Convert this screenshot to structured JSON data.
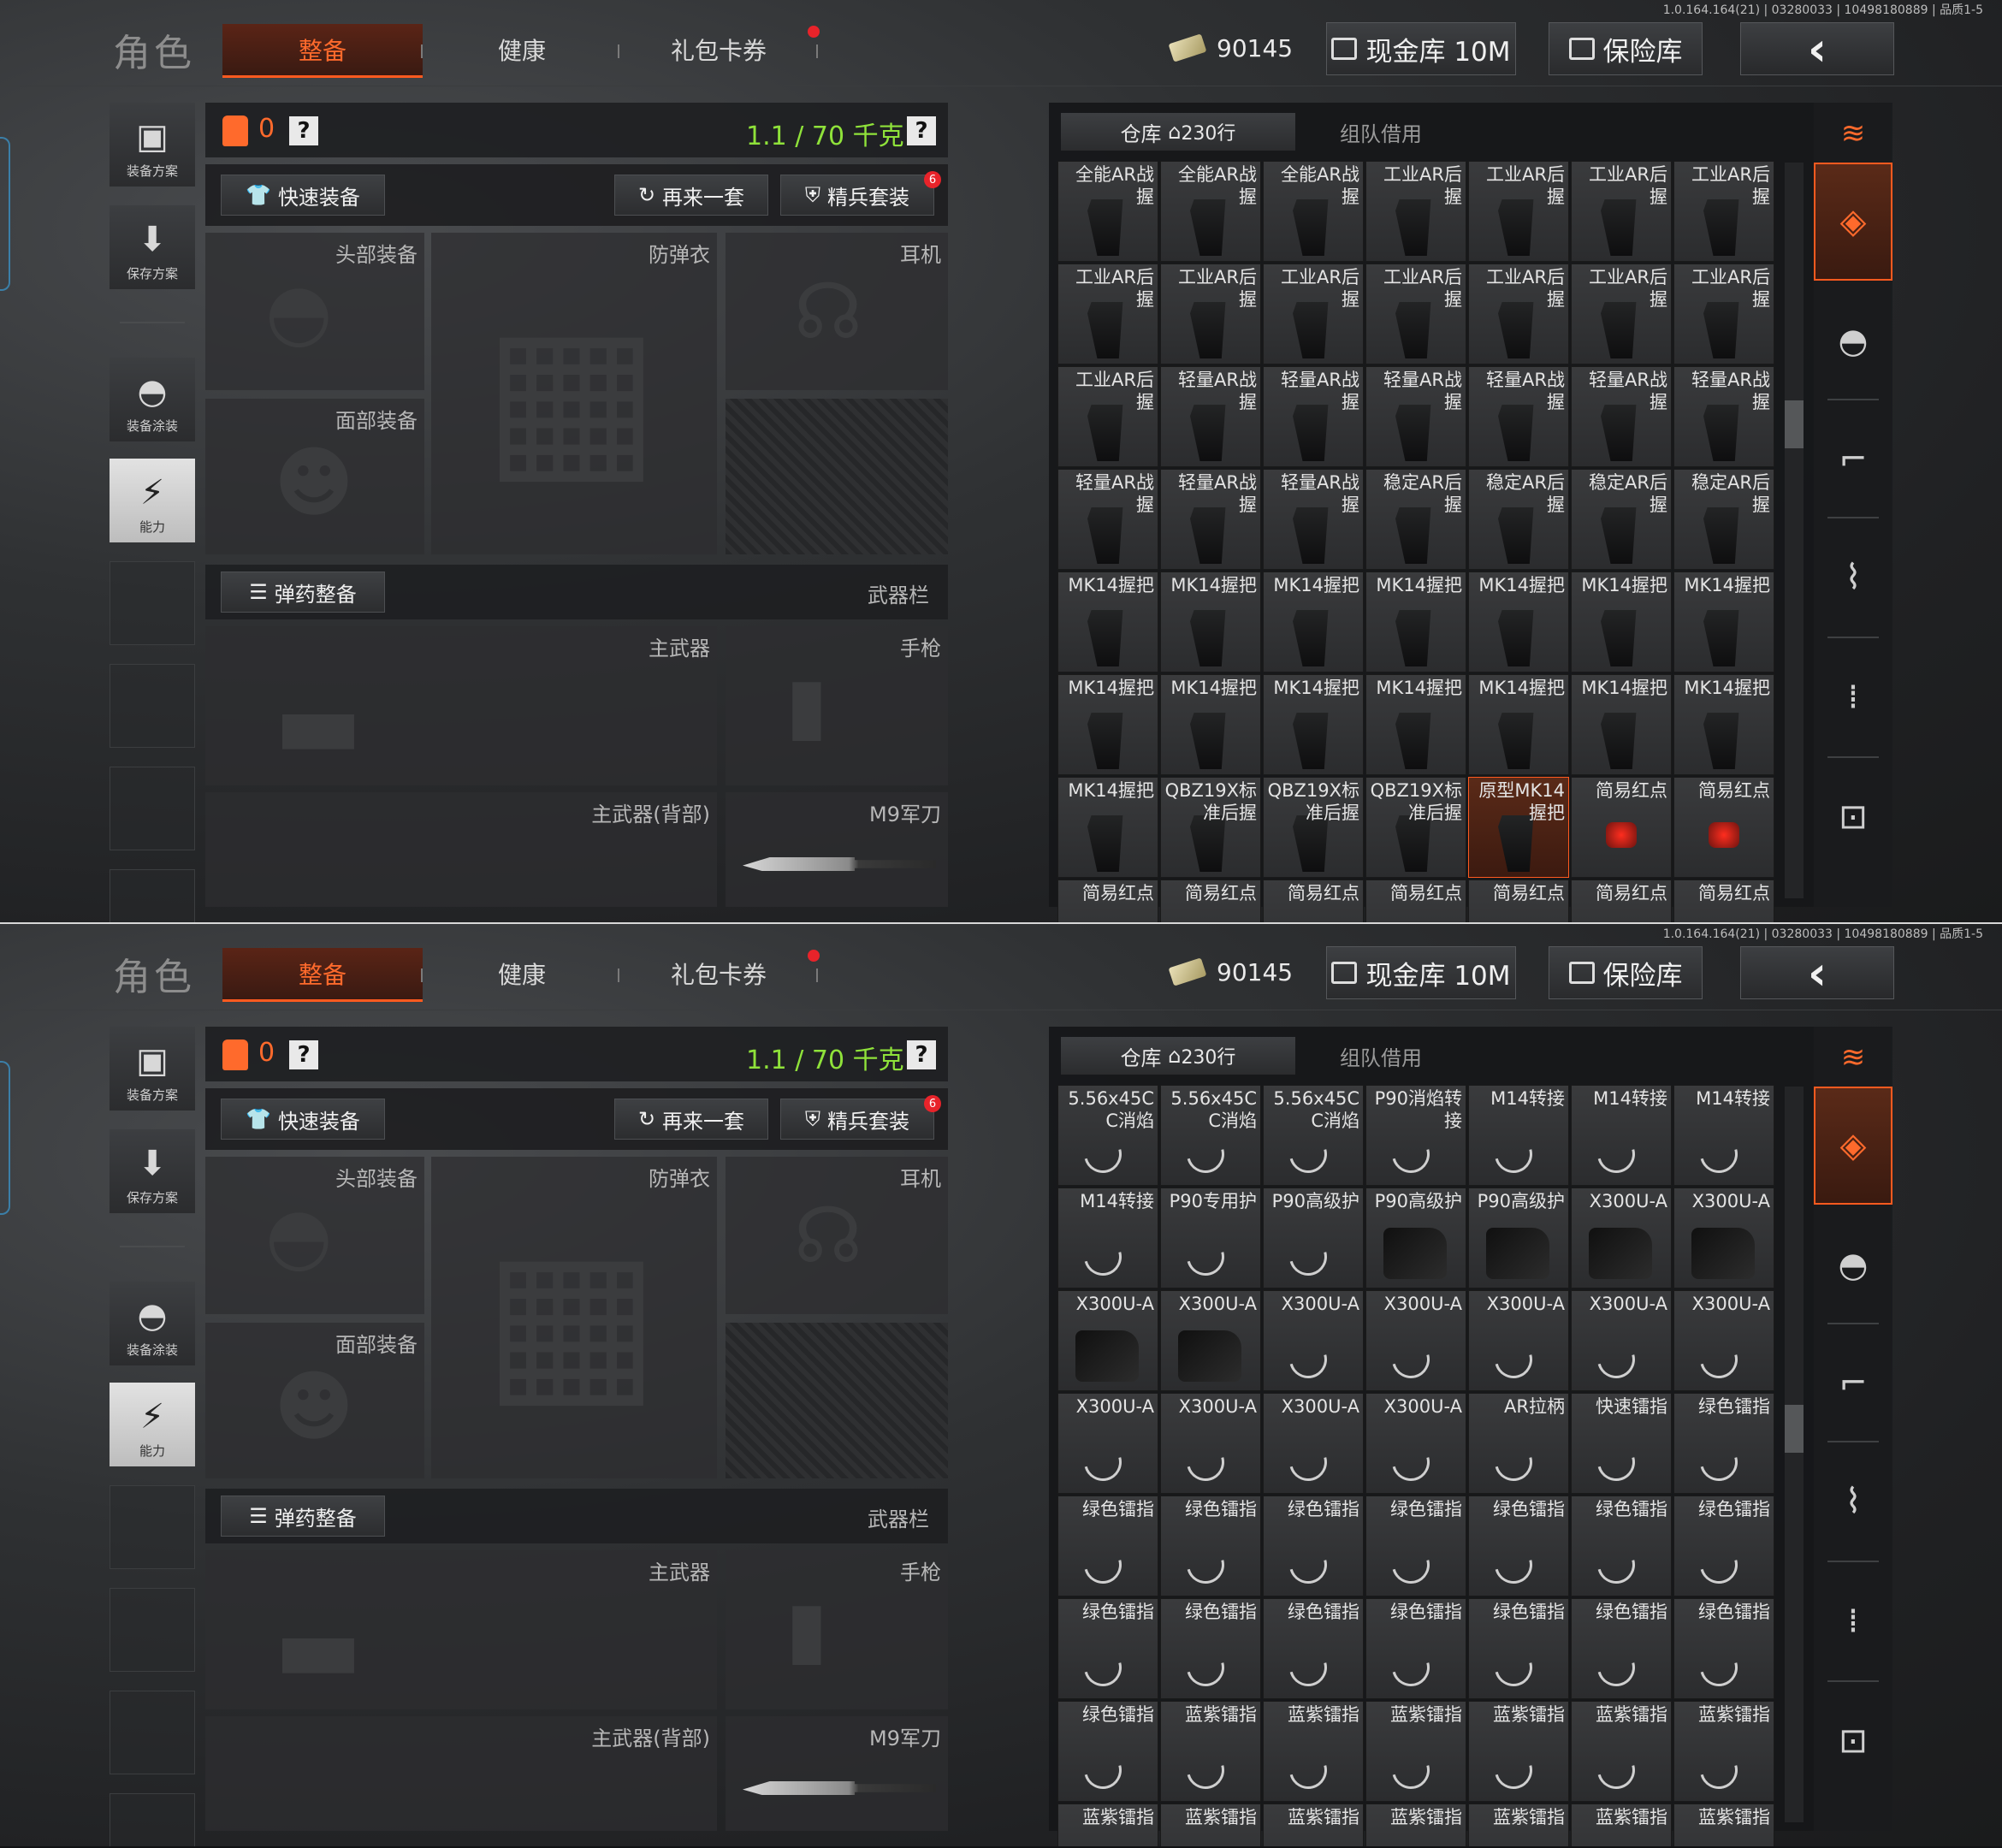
{
  "version": "1.0.164.164(21) | 03280033 | 10498180889 | 品质1-5",
  "header": {
    "role": "角色",
    "tabs": [
      "整备",
      "健康",
      "礼包卡券"
    ],
    "money": "90145",
    "cash_storage": "现金库 10M",
    "safe": "保险库",
    "back_icon": "‹"
  },
  "rail": {
    "loadout": "装备方案",
    "save": "保存方案",
    "paint": "装备涂装",
    "ability": "能力"
  },
  "equip": {
    "armor_count": "0",
    "help": "?",
    "weight": "1.1 / 70 千克",
    "quick_equip": "快速装备",
    "again": "再来一套",
    "elite": "精兵套装",
    "elite_badge": "6",
    "slots": {
      "head": "头部装备",
      "vest": "防弹衣",
      "ear": "耳机",
      "face": "面部装备",
      "ammo": "弹药整备",
      "weapon_bar": "武器栏",
      "primary": "主武器",
      "pistol": "手枪",
      "primary_back": "主武器(背部)",
      "knife": "M9军刀"
    }
  },
  "warehouse": {
    "tab_main": "仓库",
    "rows_count": "230行",
    "tab_team": "组队借用"
  },
  "grid1": [
    [
      "全能AR战握",
      "全能AR战握",
      "全能AR战握",
      "工业AR后握",
      "工业AR后握",
      "工业AR后握",
      "工业AR后握"
    ],
    [
      "工业AR后握",
      "工业AR后握",
      "工业AR后握",
      "工业AR后握",
      "工业AR后握",
      "工业AR后握",
      "工业AR后握"
    ],
    [
      "工业AR后握",
      "轻量AR战握",
      "轻量AR战握",
      "轻量AR战握",
      "轻量AR战握",
      "轻量AR战握",
      "轻量AR战握"
    ],
    [
      "轻量AR战握",
      "轻量AR战握",
      "轻量AR战握",
      "稳定AR后握",
      "稳定AR后握",
      "稳定AR后握",
      "稳定AR后握"
    ],
    [
      "MK14握把",
      "MK14握把",
      "MK14握把",
      "MK14握把",
      "MK14握把",
      "MK14握把",
      "MK14握把"
    ],
    [
      "MK14握把",
      "MK14握把",
      "MK14握把",
      "MK14握把",
      "MK14握把",
      "MK14握把",
      "MK14握把"
    ],
    [
      "MK14握把",
      "QBZ19X标准后握",
      "QBZ19X标准后握",
      "QBZ19X标准后握",
      "原型MK14握把",
      "简易红点",
      "简易红点"
    ],
    [
      "简易红点",
      "简易红点",
      "简易红点",
      "简易红点",
      "简易红点",
      "简易红点",
      "简易红点"
    ]
  ],
  "grid2": [
    [
      "5.56x45CC消焰",
      "5.56x45CC消焰",
      "5.56x45CC消焰",
      "P90消焰转接",
      "M14转接",
      "M14转接",
      "M14转接"
    ],
    [
      "M14转接",
      "P90专用护",
      "P90高级护",
      "P90高级护",
      "P90高级护",
      "X300U-A",
      "X300U-A"
    ],
    [
      "X300U-A",
      "X300U-A",
      "X300U-A",
      "X300U-A",
      "X300U-A",
      "X300U-A",
      "X300U-A"
    ],
    [
      "X300U-A",
      "X300U-A",
      "X300U-A",
      "X300U-A",
      "AR拉柄",
      "快速镭指",
      "绿色镭指"
    ],
    [
      "绿色镭指",
      "绿色镭指",
      "绿色镭指",
      "绿色镭指",
      "绿色镭指",
      "绿色镭指",
      "绿色镭指"
    ],
    [
      "绿色镭指",
      "绿色镭指",
      "绿色镭指",
      "绿色镭指",
      "绿色镭指",
      "绿色镭指",
      "绿色镭指"
    ],
    [
      "绿色镭指",
      "蓝紫镭指",
      "蓝紫镭指",
      "蓝紫镭指",
      "蓝紫镭指",
      "蓝紫镭指",
      "蓝紫镭指"
    ],
    [
      "蓝紫镭指",
      "蓝紫镭指",
      "蓝紫镭指",
      "蓝紫镭指",
      "蓝紫镭指",
      "蓝紫镭指",
      "蓝紫镭指"
    ]
  ],
  "colors": {
    "accent": "#ff5a1f",
    "weight_green": "#8fe23a",
    "badge_red": "#e8232a"
  }
}
